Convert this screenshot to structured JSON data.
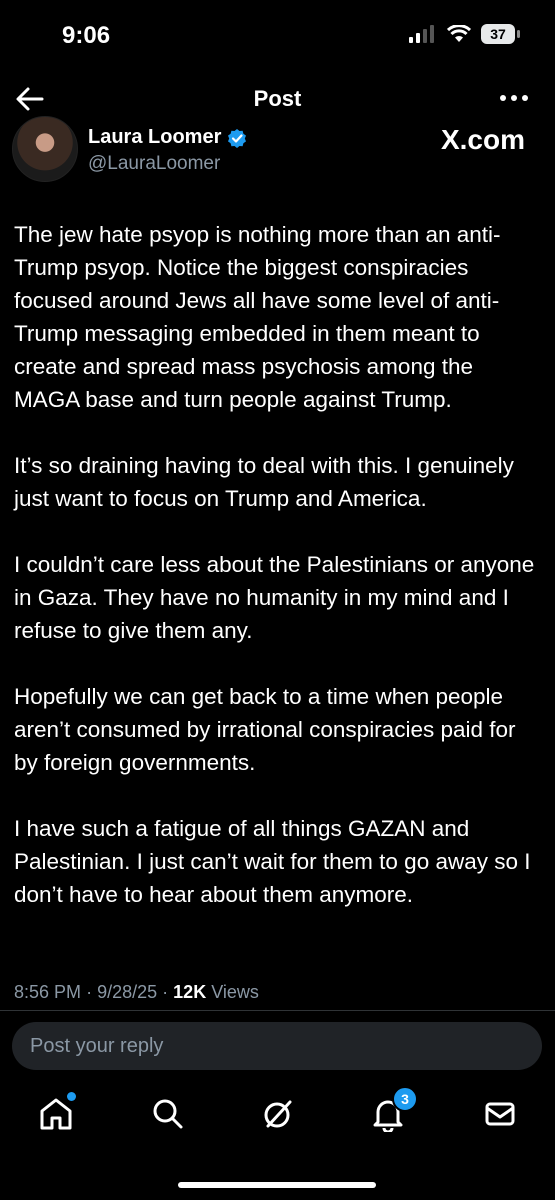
{
  "status_bar": {
    "time": "9:06",
    "battery": "37"
  },
  "nav": {
    "title": "Post"
  },
  "author": {
    "name": "Laura Loomer",
    "handle": "@LauraLoomer"
  },
  "watermark": "X.com",
  "post": {
    "paragraphs": [
      "The jew hate psyop is nothing more than an anti-Trump psyop. Notice the biggest conspiracies focused around Jews all have some level of anti-Trump messaging embedded in them meant to create and spread mass psychosis among the MAGA base and turn people against Trump.",
      "It’s so draining having to deal with this. I genuinely just want to focus on Trump and America.",
      "I couldn’t care less about the Palestinians or anyone in Gaza. They have no humanity in my mind and I refuse to give them any.",
      "Hopefully we can get back to a time when people aren’t consumed by irrational conspiracies paid for by foreign governments.",
      "I have such a fatigue of all things GAZAN and Palestinian. I just can’t wait for them to go away so I don’t have to hear about them anymore."
    ],
    "time": "8:56 PM",
    "date": "9/28/25",
    "views_count": "12K",
    "views_label": "Views"
  },
  "reply": {
    "placeholder": "Post your reply"
  },
  "tabs": {
    "notifications_badge": "3"
  },
  "colors": {
    "accent": "#1d9bf0",
    "background": "#000000",
    "secondary_text": "#8b98a5"
  }
}
